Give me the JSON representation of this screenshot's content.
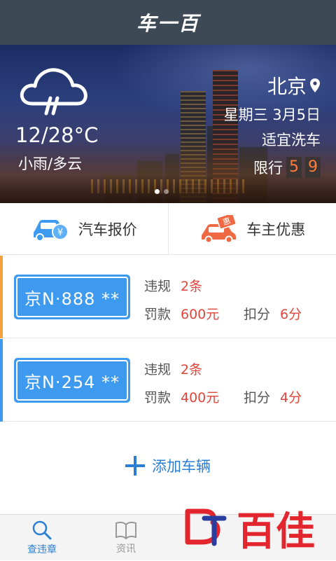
{
  "app": {
    "title": "车一百"
  },
  "weather": {
    "icon": "rain-cloud-icon",
    "temperature": "12/28°C",
    "condition": "小雨/多云",
    "city": "北京",
    "date": "星期三  3月5日",
    "wash_advice": "适宜洗车",
    "limit_label": "限行",
    "limit_numbers": [
      "5",
      "9"
    ],
    "carousel_pages": 2,
    "carousel_active": 1
  },
  "quick_actions": [
    {
      "label": "汽车报价",
      "icon": "car-price-icon"
    },
    {
      "label": "车主优惠",
      "icon": "car-discount-icon"
    }
  ],
  "badge": {
    "discount_char": "惠",
    "price_char": "¥"
  },
  "cars": [
    {
      "plate": "京N·888 **",
      "violation_label": "违规",
      "violation_value": "2条",
      "fine_label": "罚款",
      "fine_value": "600元",
      "points_label": "扣分",
      "points_value": "6分",
      "accent": "#f5a23c"
    },
    {
      "plate": "京N·254 **",
      "violation_label": "违规",
      "violation_value": "2条",
      "fine_label": "罚款",
      "fine_value": "400元",
      "points_label": "扣分",
      "points_value": "4分",
      "accent": "#3d9aef"
    }
  ],
  "add_vehicle": {
    "label": "添加车辆"
  },
  "tabs": [
    {
      "label": "查违章",
      "icon": "search-icon",
      "active": true
    },
    {
      "label": "资讯",
      "icon": "book-icon",
      "active": false
    }
  ],
  "watermark": {
    "text": "百佳"
  },
  "colors": {
    "primary": "#2a7fd4",
    "plate": "#3d9aef",
    "alert": "#e0463c",
    "titlebar": "#3d4a55"
  }
}
